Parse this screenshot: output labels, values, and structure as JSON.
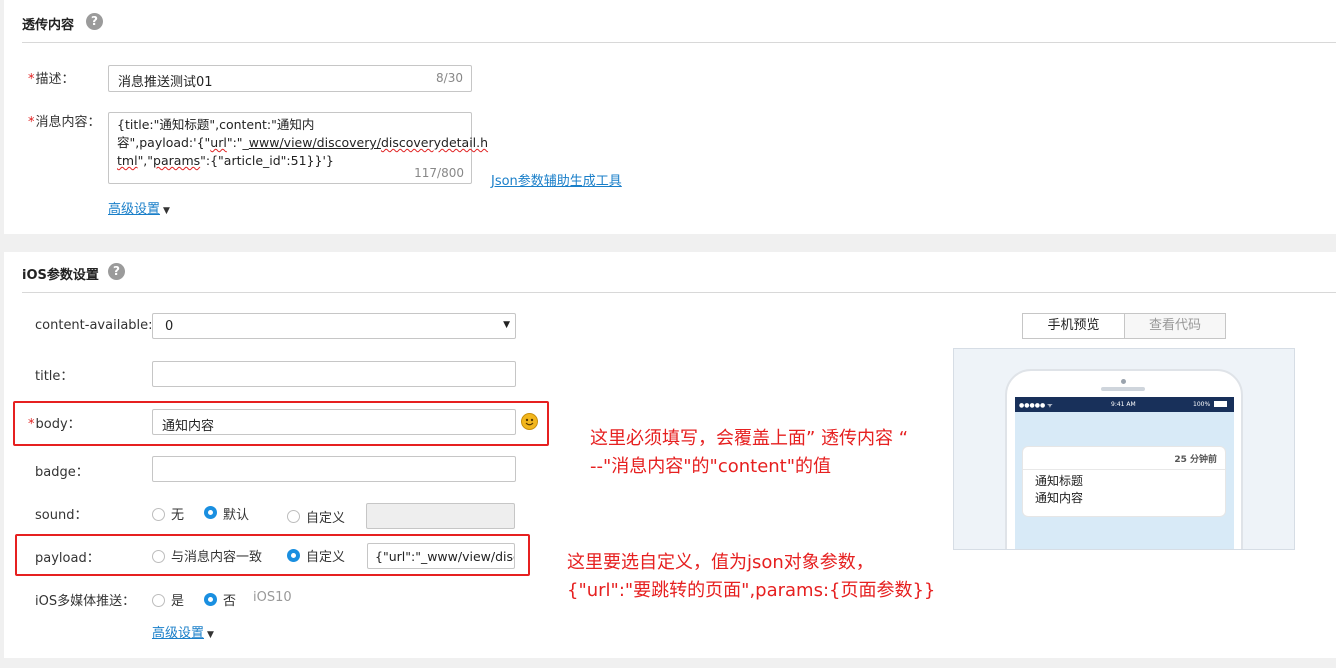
{
  "passthrough": {
    "title": "透传内容",
    "desc_label": "描述：",
    "desc_value": "消息推送测试01",
    "desc_counter": "8/30",
    "msg_label": "消息内容：",
    "msg_line1": "{title:\"通知标题\",content:\"通知内",
    "msg_line2_a": "容\",payload:'{\"",
    "msg_line2_url": "url",
    "msg_line2_b": "\":\"_",
    "msg_line2_www": "www/view/discovery/",
    "msg_line2_detail": "discoverydetail.h",
    "msg_line3_tml": "tml",
    "msg_line3_a": "\",\"",
    "msg_line3_params": "params",
    "msg_line3_b": "\":{\"article_id\":51}}'}",
    "msg_counter": "117/800",
    "json_tool_link": "Json参数辅助生成工具",
    "advanced_link": "高级设置"
  },
  "ios": {
    "title": "iOS参数设置",
    "content_available_label": "content-available:",
    "content_available_value": "0",
    "title_label": "title：",
    "body_label": "body：",
    "body_value": "通知内容",
    "badge_label": "badge：",
    "sound_label": "sound：",
    "sound_options": [
      "无",
      "默认",
      "自定义"
    ],
    "payload_label": "payload：",
    "payload_options": [
      "与消息内容一致",
      "自定义"
    ],
    "payload_value": "{\"url\":\"_www/view/disco",
    "media_label": "iOS多媒体推送：",
    "media_options": [
      "是",
      "否"
    ],
    "media_note": "iOS10",
    "advanced_link": "高级设置"
  },
  "preview": {
    "tab_phone": "手机预览",
    "tab_code": "查看代码",
    "status_left": "●●●●● ᯤ",
    "status_time": "9:41 AM",
    "status_right": "100%",
    "notif_time": "25 分钟前",
    "notif_title": "通知标题",
    "notif_body": "通知内容"
  },
  "annotations": {
    "note1_line1": "这里必须填写，会覆盖上面” 透传内容 “",
    "note1_line2": "--\"消息内容\"的\"content\"的值",
    "note2_line1": "这里要选自定义，值为json对象参数，",
    "note2_line2": "{\"url\":\"要跳转的页面\",params:{页面参数}}"
  },
  "colors": {
    "accent": "#1a8fe0",
    "link": "#1a7fc9",
    "annotation_red": "#e62020",
    "required_star": "#e02020"
  }
}
